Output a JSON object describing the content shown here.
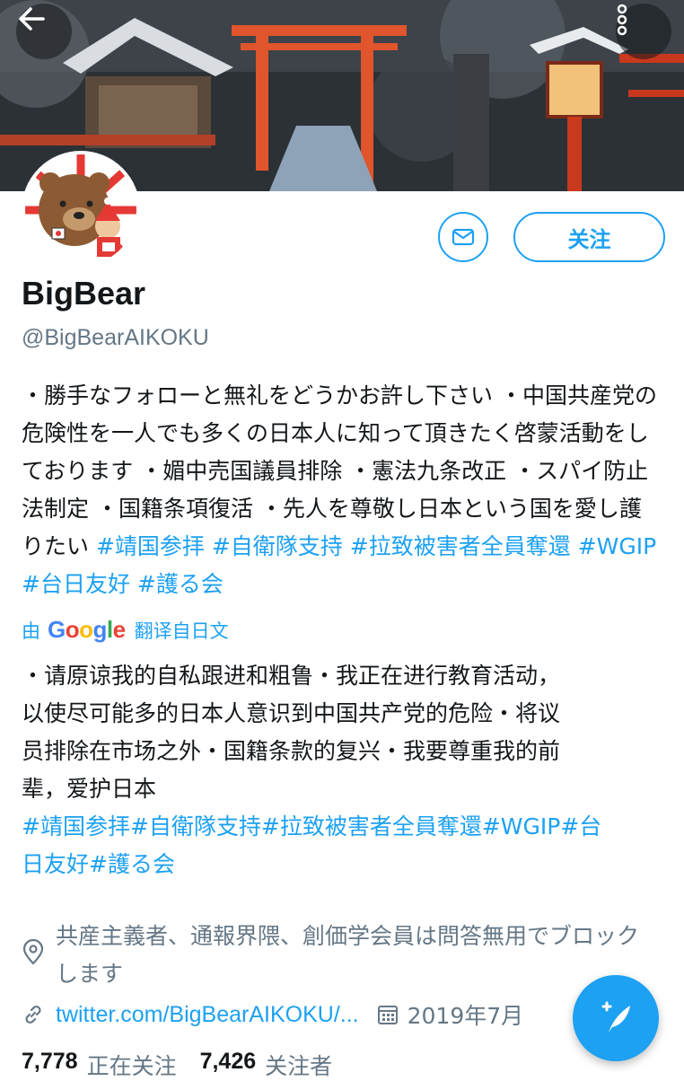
{
  "header": {
    "back_icon": "back-arrow-icon",
    "more_icon": "more-vertical-icon"
  },
  "profile": {
    "name": "BigBear",
    "handle": "@BigBearAIKOKU",
    "follow_label": "关注"
  },
  "bio": {
    "text": "・勝手なフォローと無礼をどうかお許し下さい ・中国共産党の危険性を一人でも多くの日本人に知って頂きたく啓蒙活動をしております ・媚中売国議員排除 ・憲法九条改正 ・スパイ防止法制定 ・国籍条項復活 ・先人を尊敬し日本という国を愛し護りたい ",
    "hashtags": [
      "#靖国参拝",
      "#自衛隊支持",
      "#拉致被害者全員奪還",
      "#WGIP",
      "#台日友好",
      "#護る会"
    ]
  },
  "translation": {
    "prefix": "由",
    "provider": "Google",
    "suffix": "翻译自日文",
    "lines": [
      "・请原谅我的自私跟进和粗鲁・我正在进行教育活动，",
      "以使尽可能多的日本人意识到中国共产党的危险・将议",
      "员排除在市场之外・国籍条款的复兴・我要尊重我的前",
      "辈，爱护日本"
    ],
    "hashtag_lines": [
      "#靖国参拝#自衛隊支持#拉致被害者全員奪還#WGIP#台",
      "日友好#護る会"
    ]
  },
  "meta": {
    "location": "共産主義者、通報界隈、創価学会員は問答無用でブロックします",
    "link": "twitter.com/BigBearAIKOKU/...",
    "joined": "2019年7月"
  },
  "stats": {
    "following_count": "7,778",
    "following_label": "正在关注",
    "followers_count": "7,426",
    "followers_label": "关注者"
  },
  "colors": {
    "accent": "#1da1f2",
    "secondary_text": "#657786"
  }
}
